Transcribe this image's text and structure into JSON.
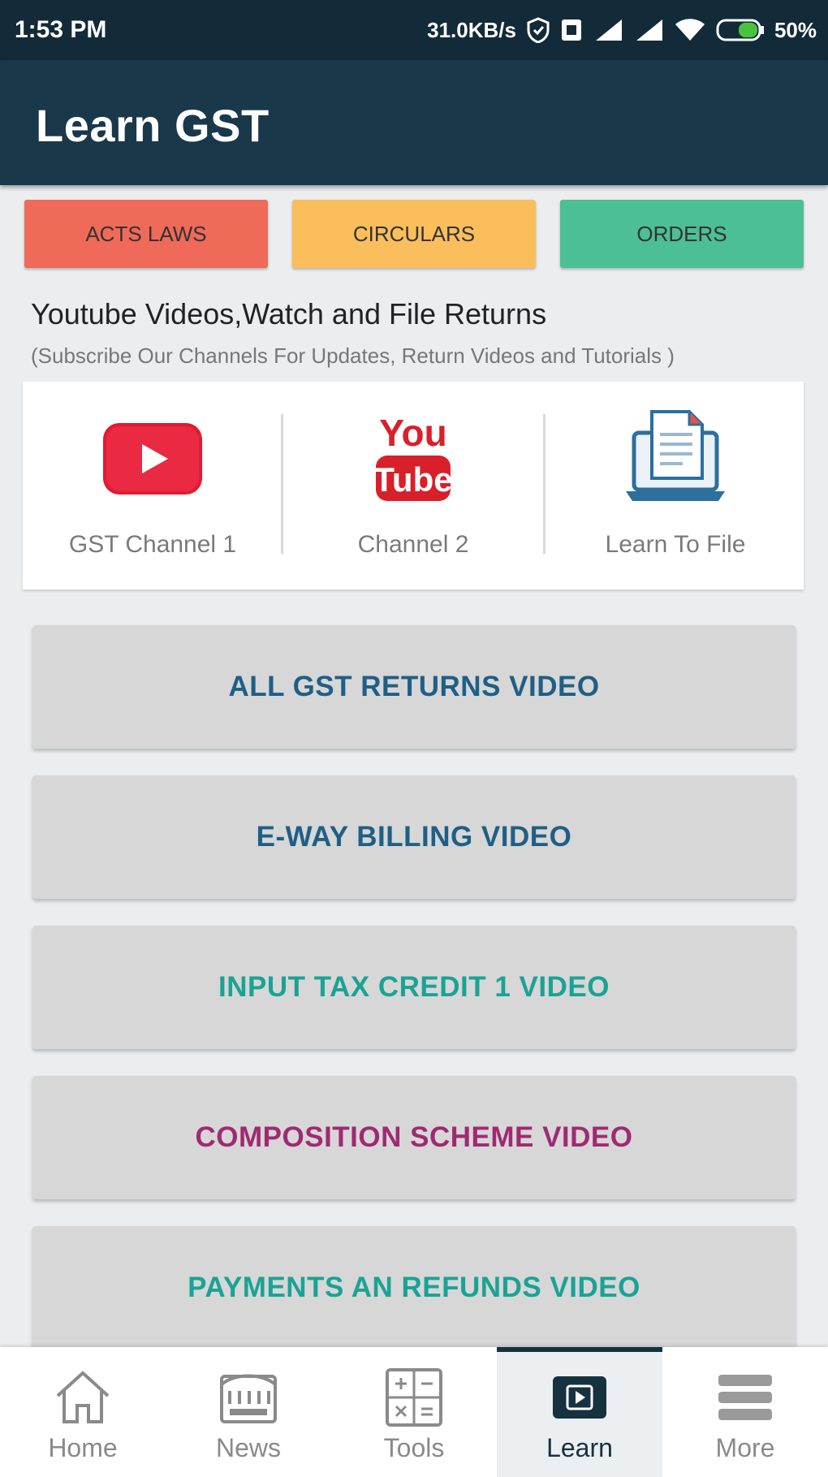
{
  "status_bar": {
    "time": "1:53 PM",
    "speed": "31.0KB/s",
    "battery": "50%"
  },
  "app_bar": {
    "title": "Learn GST"
  },
  "categories": [
    {
      "label": "ACTS LAWS",
      "color": "#ef6a58"
    },
    {
      "label": "CIRCULARS",
      "color": "#fbbe5c"
    },
    {
      "label": "ORDERS",
      "color": "#4cbf95"
    }
  ],
  "section": {
    "title": "Youtube Videos,Watch and File Returns",
    "subtitle": "(Subscribe Our Channels For Updates, Return Videos and Tutorials )"
  },
  "channels": [
    {
      "label": "GST Channel 1",
      "icon": "youtube-play-icon"
    },
    {
      "label": "Channel 2",
      "icon": "youtube-logo-icon"
    },
    {
      "label": "Learn To File",
      "icon": "laptop-document-icon"
    }
  ],
  "video_buttons": [
    {
      "label": "ALL GST RETURNS VIDEO",
      "color": "#1f5f86"
    },
    {
      "label": "E-WAY BILLING VIDEO",
      "color": "#1f5f86"
    },
    {
      "label": "INPUT TAX CREDIT 1 VIDEO",
      "color": "#1aa395"
    },
    {
      "label": "COMPOSITION SCHEME VIDEO",
      "color": "#a02a72"
    },
    {
      "label": "PAYMENTS AN REFUNDS VIDEO",
      "color": "#1aa395"
    }
  ],
  "bottom_nav": [
    {
      "label": "Home",
      "icon": "home-icon"
    },
    {
      "label": "News",
      "icon": "newspaper-icon"
    },
    {
      "label": "Tools",
      "icon": "calculator-icon"
    },
    {
      "label": "Learn",
      "icon": "video-play-icon",
      "active": true
    },
    {
      "label": "More",
      "icon": "stack-icon"
    }
  ]
}
